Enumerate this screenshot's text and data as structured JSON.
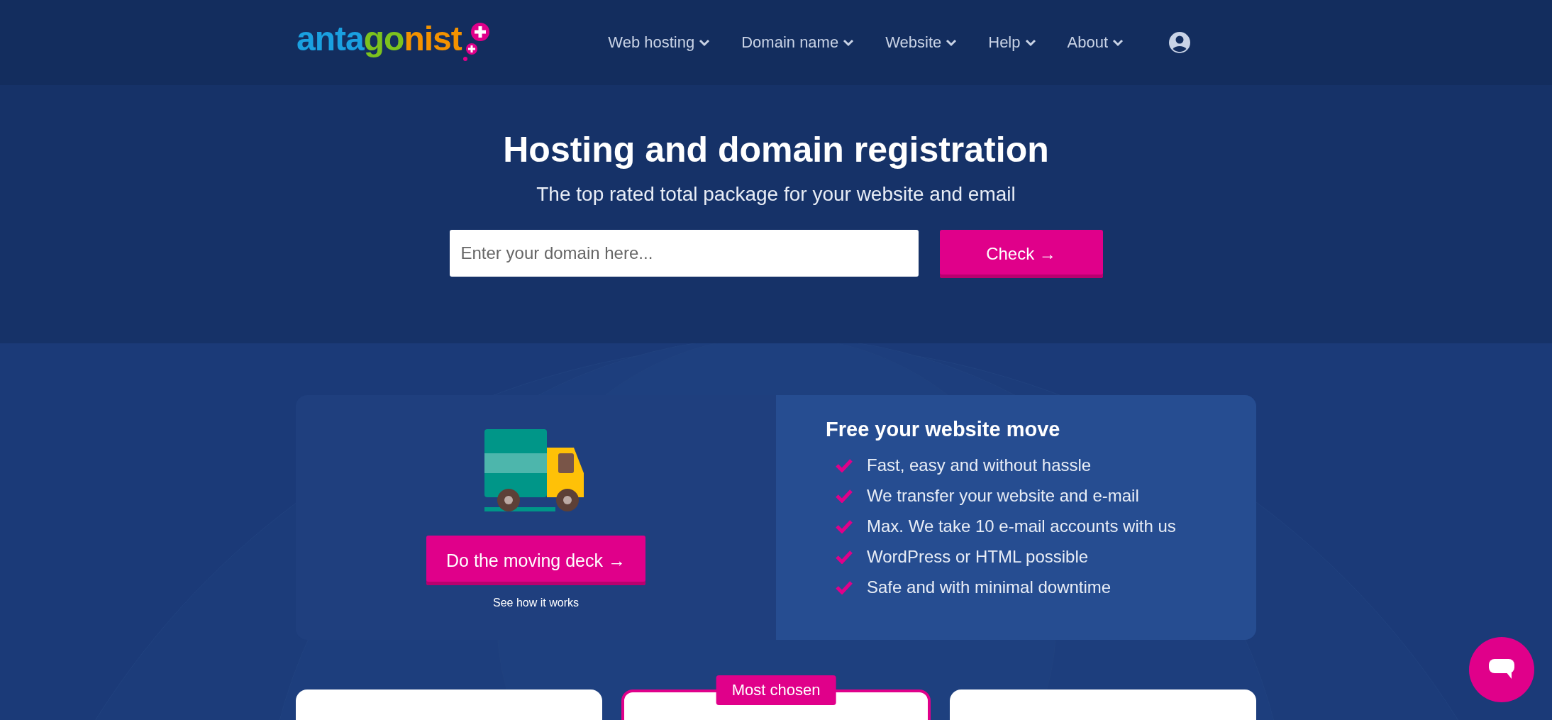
{
  "header": {
    "logo": "antagonist",
    "nav": [
      {
        "label": "Web hosting"
      },
      {
        "label": "Domain name"
      },
      {
        "label": "Website"
      },
      {
        "label": "Help"
      },
      {
        "label": "About"
      }
    ]
  },
  "hero": {
    "title": "Hosting and domain registration",
    "subtitle": "The top rated total package for your website and email",
    "search": {
      "placeholder": "Enter your domain here..."
    },
    "button": "Check →"
  },
  "move": {
    "button": "Do the moving deck →",
    "link": "See how it works",
    "title": "Free your website move",
    "features": [
      "Fast, easy and without hassle",
      "We transfer your website and e-mail",
      "Max. We take 10 e-mail accounts with us",
      "WordPress or HTML possible",
      "Safe and with minimal downtime"
    ]
  },
  "plans": [
    {
      "highlighted": false
    },
    {
      "highlighted": true,
      "badge": "Most chosen"
    },
    {
      "highlighted": false
    }
  ]
}
